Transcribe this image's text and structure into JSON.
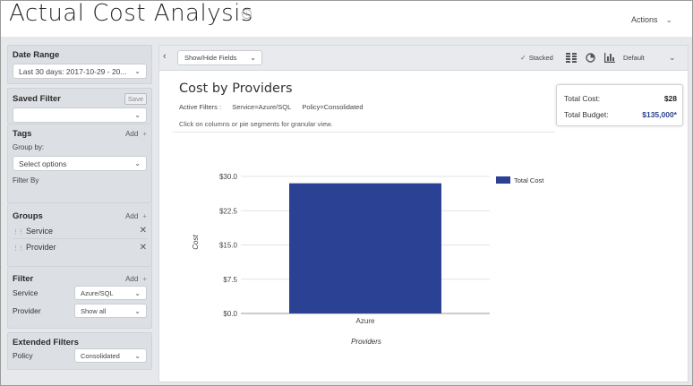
{
  "header": {
    "title": "Actual Cost Analysis",
    "info_icon": "info-icon",
    "actions_label": "Actions"
  },
  "sidebar": {
    "date_range": {
      "title": "Date Range",
      "value": "Last 30 days:  2017-10-29 - 20..."
    },
    "saved_filter": {
      "title": "Saved Filter",
      "save_label": "Save",
      "value": ""
    },
    "tags": {
      "title": "Tags",
      "add_label": "Add",
      "group_by_label": "Group by:",
      "select_placeholder": "Select options",
      "filter_by_label": "Filter By"
    },
    "groups": {
      "title": "Groups",
      "add_label": "Add",
      "items": [
        {
          "label": "Service"
        },
        {
          "label": "Provider"
        }
      ]
    },
    "filter": {
      "title": "Filter",
      "add_label": "Add",
      "rows": [
        {
          "label": "Service",
          "value": "Azure/SQL"
        },
        {
          "label": "Provider",
          "value": "Show all"
        }
      ]
    },
    "extended_filters": {
      "title": "Extended Filters",
      "rows": [
        {
          "label": "Policy",
          "value": "Consolidated"
        }
      ]
    }
  },
  "toolbar": {
    "show_hide_label": "Show/Hide Fields",
    "stacked_label": "Stacked",
    "stacked_checked": true,
    "default_label": "Default"
  },
  "report": {
    "title": "Cost by Providers",
    "active_filters_label": "Active Filters :",
    "active_filters": [
      "Service=Azure/SQL",
      "Policy=Consolidated"
    ],
    "hint": "Click on columns or pie segments for granular view.",
    "total_cost_label": "Total Cost:",
    "total_cost_value": "$28",
    "total_budget_label": "Total Budget:",
    "total_budget_value": "$135,000*"
  },
  "chart_data": {
    "type": "bar",
    "categories": [
      "Azure"
    ],
    "series": [
      {
        "name": "Total Cost",
        "values": [
          28.5
        ],
        "color": "#2b4193"
      }
    ],
    "xlabel": "Providers",
    "ylabel": "Cost",
    "ylim": [
      0,
      30
    ],
    "yticks": [
      "$0.0",
      "$7.5",
      "$15.0",
      "$22.5",
      "$30.0"
    ],
    "ytick_values": [
      0,
      7.5,
      15,
      22.5,
      30
    ],
    "grid": true,
    "legend_position": "right"
  }
}
